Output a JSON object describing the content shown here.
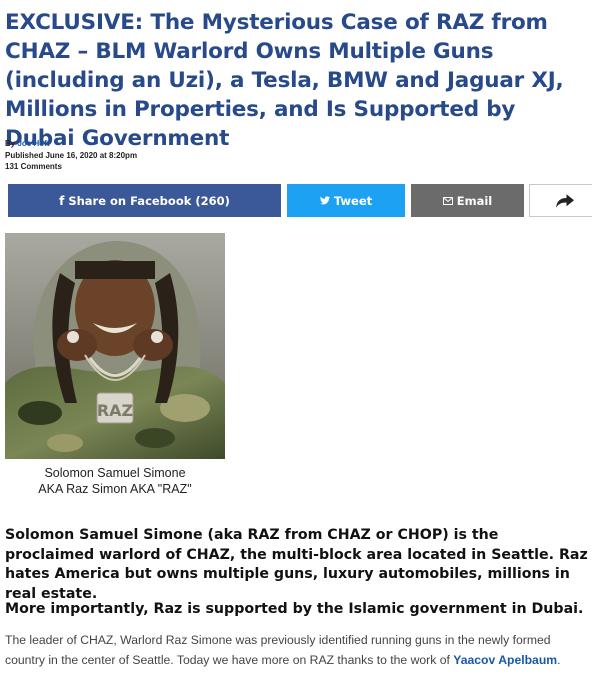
{
  "article": {
    "headline": "EXCLUSIVE: The Mysterious Case of RAZ from CHAZ – BLM Warlord Owns Multiple Guns (including an Uzi), a Tesla, BMW and Jaguar XJ, Millions in Properties, and Is Supported by Dubai Government",
    "byline_prefix": "By",
    "author": "Joe Hoft",
    "published": "Published June 16, 2020 at 8:20pm",
    "comments": "131 Comments"
  },
  "share": {
    "facebook_label": "Share on Facebook (260)",
    "tweet_label": "Tweet",
    "email_label": "Email",
    "colors": {
      "facebook": "#3b5998",
      "twitter": "#1da1f2",
      "email": "#6b6b6b"
    }
  },
  "image": {
    "caption_line1": "Solomon Samuel Simone",
    "caption_line2": "AKA Raz Simon AKA \"RAZ\"",
    "pendant_text": "RAZ"
  },
  "content": {
    "lead": "Solomon Samuel Simone (aka RAZ from CHAZ or CHOP) is the proclaimed warlord of CHAZ, the multi-block area located in Seattle.  Raz hates America but owns multiple guns, luxury automobiles, millions in real estate.",
    "lead2": "More importantly, Raz is supported by the Islamic government in Dubai.",
    "body_text": "The leader of CHAZ, Warlord Raz Simone was previously identified running guns in the newly formed country in the center of Seattle.  Today we have more on RAZ thanks to the work of ",
    "body_link": "Yaacov Apelbaum",
    "body_end": "."
  }
}
